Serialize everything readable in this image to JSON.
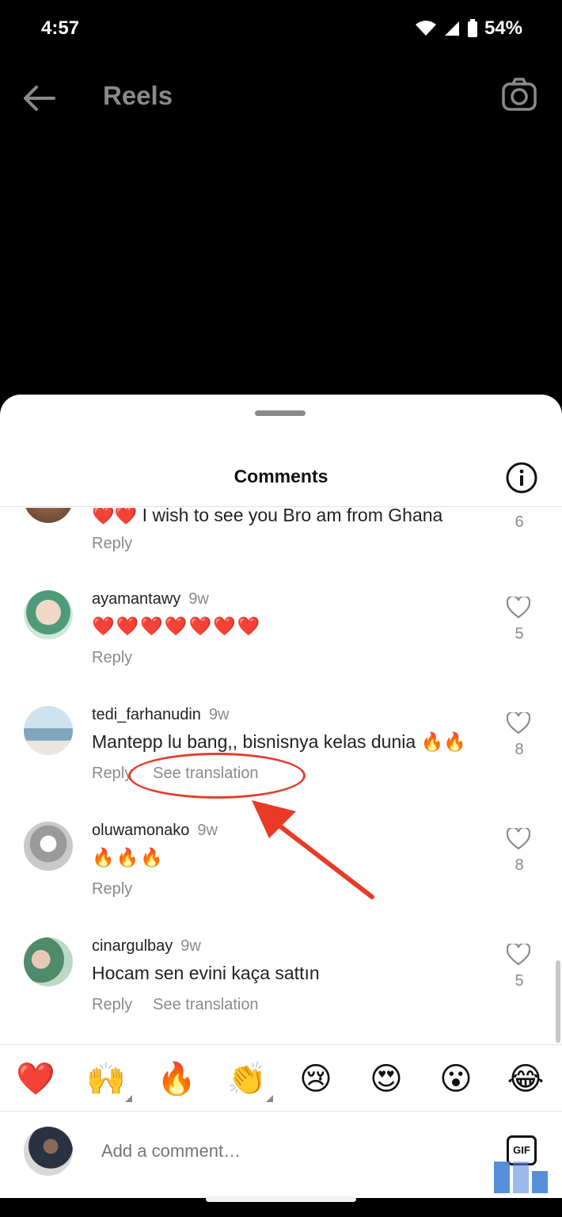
{
  "status": {
    "time": "4:57",
    "battery": "54%"
  },
  "topbar": {
    "title": "Reels"
  },
  "sheet": {
    "title": "Comments"
  },
  "comments": [
    {
      "username": "",
      "time": "",
      "text": "❤️❤️ I wish to see you Bro am from Ghana",
      "reply": "Reply",
      "translation": "",
      "likes": "6"
    },
    {
      "username": "ayamantawy",
      "time": "9w",
      "text": "❤️❤️❤️❤️❤️❤️❤️",
      "reply": "Reply",
      "translation": "",
      "likes": "5"
    },
    {
      "username": "tedi_farhanudin",
      "time": "9w",
      "text": "Mantepp lu bang,, bisnisnya kelas dunia 🔥🔥",
      "reply": "Reply",
      "translation": "See translation",
      "likes": "8"
    },
    {
      "username": "oluwamonako",
      "time": "9w",
      "text": "🔥🔥🔥",
      "reply": "Reply",
      "translation": "",
      "likes": "8"
    },
    {
      "username": "cinargulbay",
      "time": "9w",
      "text": "Hocam sen evini kaça sattın",
      "reply": "Reply",
      "translation": "See translation",
      "likes": "5"
    }
  ],
  "reactions": [
    "❤️",
    "🙌",
    "🔥",
    "👏",
    "😢",
    "😍",
    "😮",
    "😂"
  ],
  "composer": {
    "placeholder": "Add a comment…",
    "gif_label": "GIF"
  },
  "colors": {
    "annotation": "#e0402e",
    "sheet_bg": "#ffffff",
    "muted_text": "#8a8a8a"
  },
  "icons": [
    "back-arrow-icon",
    "camera-icon",
    "info-icon",
    "heart-icon",
    "gif-icon"
  ]
}
